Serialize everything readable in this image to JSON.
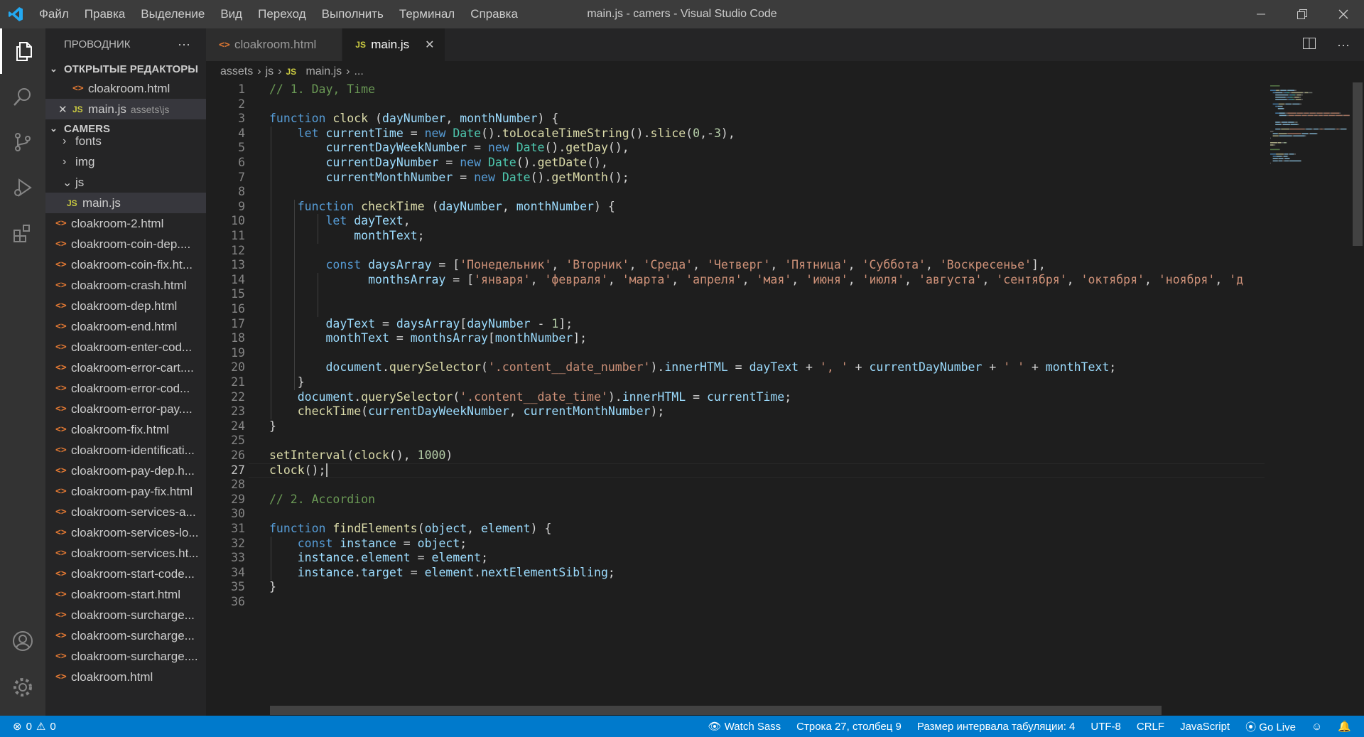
{
  "app": {
    "title": "main.js - camers - Visual Studio Code"
  },
  "menu": [
    "Файл",
    "Правка",
    "Выделение",
    "Вид",
    "Переход",
    "Выполнить",
    "Терминал",
    "Справка"
  ],
  "colors": {
    "titlebar": "#3c3c3c",
    "activitybar": "#333333",
    "sidebar": "#252526",
    "editor": "#1e1e1e",
    "statusbar": "#007acc",
    "accent": "#007acc"
  },
  "activity_icons": [
    "files-icon",
    "search-icon",
    "source-control-icon",
    "run-debug-icon",
    "extensions-icon",
    "account-icon",
    "settings-gear-icon"
  ],
  "sidebar": {
    "title": "ПРОВОДНИК",
    "more": "···",
    "open_editors_title": "ОТКРЫТЫЕ РЕДАКТОРЫ",
    "open_editors": [
      {
        "name": "cloakroom.html",
        "desc": "",
        "type": "html",
        "close": ""
      },
      {
        "name": "main.js",
        "desc": "assets\\js",
        "type": "js",
        "close": "✕"
      }
    ],
    "folder_title": "CAMERS",
    "tree": [
      {
        "name": "fonts",
        "kind": "folder",
        "chev": "›",
        "indent": 1
      },
      {
        "name": "img",
        "kind": "folder",
        "chev": "›",
        "indent": 1
      },
      {
        "name": "js",
        "kind": "folder",
        "chev": "⌄",
        "indent": 1
      },
      {
        "name": "main.js",
        "kind": "js",
        "chev": "",
        "indent": 2
      },
      {
        "name": "cloakroom-2.html",
        "kind": "html"
      },
      {
        "name": "cloakroom-coin-dep....",
        "kind": "html"
      },
      {
        "name": "cloakroom-coin-fix.ht...",
        "kind": "html"
      },
      {
        "name": "cloakroom-crash.html",
        "kind": "html"
      },
      {
        "name": "cloakroom-dep.html",
        "kind": "html"
      },
      {
        "name": "cloakroom-end.html",
        "kind": "html"
      },
      {
        "name": "cloakroom-enter-cod...",
        "kind": "html"
      },
      {
        "name": "cloakroom-error-cart....",
        "kind": "html"
      },
      {
        "name": "cloakroom-error-cod...",
        "kind": "html"
      },
      {
        "name": "cloakroom-error-pay....",
        "kind": "html"
      },
      {
        "name": "cloakroom-fix.html",
        "kind": "html"
      },
      {
        "name": "cloakroom-identificati...",
        "kind": "html"
      },
      {
        "name": "cloakroom-pay-dep.h...",
        "kind": "html"
      },
      {
        "name": "cloakroom-pay-fix.html",
        "kind": "html"
      },
      {
        "name": "cloakroom-services-a...",
        "kind": "html"
      },
      {
        "name": "cloakroom-services-lo...",
        "kind": "html"
      },
      {
        "name": "cloakroom-services.ht...",
        "kind": "html"
      },
      {
        "name": "cloakroom-start-code...",
        "kind": "html"
      },
      {
        "name": "cloakroom-start.html",
        "kind": "html"
      },
      {
        "name": "cloakroom-surcharge...",
        "kind": "html"
      },
      {
        "name": "cloakroom-surcharge...",
        "kind": "html"
      },
      {
        "name": "cloakroom-surcharge....",
        "kind": "html"
      },
      {
        "name": "cloakroom.html",
        "kind": "html"
      }
    ]
  },
  "tabs": [
    {
      "label": "cloakroom.html",
      "type": "html",
      "active": false,
      "close": ""
    },
    {
      "label": "main.js",
      "type": "js",
      "active": true,
      "close": "✕"
    }
  ],
  "breadcrumb": [
    "assets",
    "js",
    "main.js",
    "..."
  ],
  "editor": {
    "current_line": 27,
    "lines": [
      [
        [
          "c",
          "// 1. Day, Time"
        ]
      ],
      [],
      [
        [
          "k",
          "function "
        ],
        [
          "f",
          "clock"
        ],
        [
          "p",
          " ("
        ],
        [
          "v",
          "dayNumber"
        ],
        [
          "p",
          ", "
        ],
        [
          "v",
          "monthNumber"
        ],
        [
          "p",
          ") {"
        ]
      ],
      [
        [
          "p",
          "    "
        ],
        [
          "k",
          "let "
        ],
        [
          "v",
          "currentTime"
        ],
        [
          "p",
          " = "
        ],
        [
          "k",
          "new "
        ],
        [
          "t",
          "Date"
        ],
        [
          "p",
          "()."
        ],
        [
          "f",
          "toLocaleTimeString"
        ],
        [
          "p",
          "()."
        ],
        [
          "f",
          "slice"
        ],
        [
          "p",
          "("
        ],
        [
          "n",
          "0"
        ],
        [
          "p",
          ",-"
        ],
        [
          "n",
          "3"
        ],
        [
          "p",
          "),"
        ]
      ],
      [
        [
          "p",
          "        "
        ],
        [
          "v",
          "currentDayWeekNumber"
        ],
        [
          "p",
          " = "
        ],
        [
          "k",
          "new "
        ],
        [
          "t",
          "Date"
        ],
        [
          "p",
          "()."
        ],
        [
          "f",
          "getDay"
        ],
        [
          "p",
          "(),"
        ]
      ],
      [
        [
          "p",
          "        "
        ],
        [
          "v",
          "currentDayNumber"
        ],
        [
          "p",
          " = "
        ],
        [
          "k",
          "new "
        ],
        [
          "t",
          "Date"
        ],
        [
          "p",
          "()."
        ],
        [
          "f",
          "getDate"
        ],
        [
          "p",
          "(),"
        ]
      ],
      [
        [
          "p",
          "        "
        ],
        [
          "v",
          "currentMonthNumber"
        ],
        [
          "p",
          " = "
        ],
        [
          "k",
          "new "
        ],
        [
          "t",
          "Date"
        ],
        [
          "p",
          "()."
        ],
        [
          "f",
          "getMonth"
        ],
        [
          "p",
          "();"
        ]
      ],
      [],
      [
        [
          "p",
          "    "
        ],
        [
          "k",
          "function "
        ],
        [
          "f",
          "checkTime"
        ],
        [
          "p",
          " ("
        ],
        [
          "v",
          "dayNumber"
        ],
        [
          "p",
          ", "
        ],
        [
          "v",
          "monthNumber"
        ],
        [
          "p",
          ") {"
        ]
      ],
      [
        [
          "p",
          "        "
        ],
        [
          "k",
          "let "
        ],
        [
          "v",
          "dayText"
        ],
        [
          "p",
          ","
        ]
      ],
      [
        [
          "p",
          "            "
        ],
        [
          "v",
          "monthText"
        ],
        [
          "p",
          ";"
        ]
      ],
      [],
      [
        [
          "p",
          "        "
        ],
        [
          "k",
          "const "
        ],
        [
          "v",
          "daysArray"
        ],
        [
          "p",
          " = ["
        ],
        [
          "s",
          "'Понедельник'"
        ],
        [
          "p",
          ", "
        ],
        [
          "s",
          "'Вторник'"
        ],
        [
          "p",
          ", "
        ],
        [
          "s",
          "'Среда'"
        ],
        [
          "p",
          ", "
        ],
        [
          "s",
          "'Четверг'"
        ],
        [
          "p",
          ", "
        ],
        [
          "s",
          "'Пятница'"
        ],
        [
          "p",
          ", "
        ],
        [
          "s",
          "'Суббота'"
        ],
        [
          "p",
          ", "
        ],
        [
          "s",
          "'Воскресенье'"
        ],
        [
          "p",
          "],"
        ]
      ],
      [
        [
          "p",
          "              "
        ],
        [
          "v",
          "monthsArray"
        ],
        [
          "p",
          " = ["
        ],
        [
          "s",
          "'января'"
        ],
        [
          "p",
          ", "
        ],
        [
          "s",
          "'февраля'"
        ],
        [
          "p",
          ", "
        ],
        [
          "s",
          "'марта'"
        ],
        [
          "p",
          ", "
        ],
        [
          "s",
          "'апреля'"
        ],
        [
          "p",
          ", "
        ],
        [
          "s",
          "'мая'"
        ],
        [
          "p",
          ", "
        ],
        [
          "s",
          "'июня'"
        ],
        [
          "p",
          ", "
        ],
        [
          "s",
          "'июля'"
        ],
        [
          "p",
          ", "
        ],
        [
          "s",
          "'августа'"
        ],
        [
          "p",
          ", "
        ],
        [
          "s",
          "'сентября'"
        ],
        [
          "p",
          ", "
        ],
        [
          "s",
          "'октября'"
        ],
        [
          "p",
          ", "
        ],
        [
          "s",
          "'ноября'"
        ],
        [
          "p",
          ", "
        ],
        [
          "s",
          "'д"
        ]
      ],
      [],
      [],
      [
        [
          "p",
          "        "
        ],
        [
          "v",
          "dayText"
        ],
        [
          "p",
          " = "
        ],
        [
          "v",
          "daysArray"
        ],
        [
          "p",
          "["
        ],
        [
          "v",
          "dayNumber"
        ],
        [
          "p",
          " - "
        ],
        [
          "n",
          "1"
        ],
        [
          "p",
          "];"
        ]
      ],
      [
        [
          "p",
          "        "
        ],
        [
          "v",
          "monthText"
        ],
        [
          "p",
          " = "
        ],
        [
          "v",
          "monthsArray"
        ],
        [
          "p",
          "["
        ],
        [
          "v",
          "monthNumber"
        ],
        [
          "p",
          "];"
        ]
      ],
      [],
      [
        [
          "p",
          "        "
        ],
        [
          "v",
          "document"
        ],
        [
          "p",
          "."
        ],
        [
          "f",
          "querySelector"
        ],
        [
          "p",
          "("
        ],
        [
          "s",
          "'.content__date_number'"
        ],
        [
          "p",
          ")."
        ],
        [
          "v",
          "innerHTML"
        ],
        [
          "p",
          " = "
        ],
        [
          "v",
          "dayText"
        ],
        [
          "p",
          " + "
        ],
        [
          "s",
          "', '"
        ],
        [
          "p",
          " + "
        ],
        [
          "v",
          "currentDayNumber"
        ],
        [
          "p",
          " + "
        ],
        [
          "s",
          "' '"
        ],
        [
          "p",
          " + "
        ],
        [
          "v",
          "monthText"
        ],
        [
          "p",
          ";"
        ]
      ],
      [
        [
          "p",
          "    }"
        ]
      ],
      [
        [
          "p",
          "    "
        ],
        [
          "v",
          "document"
        ],
        [
          "p",
          "."
        ],
        [
          "f",
          "querySelector"
        ],
        [
          "p",
          "("
        ],
        [
          "s",
          "'.content__date_time'"
        ],
        [
          "p",
          ")."
        ],
        [
          "v",
          "innerHTML"
        ],
        [
          "p",
          " = "
        ],
        [
          "v",
          "currentTime"
        ],
        [
          "p",
          ";"
        ]
      ],
      [
        [
          "p",
          "    "
        ],
        [
          "f",
          "checkTime"
        ],
        [
          "p",
          "("
        ],
        [
          "v",
          "currentDayWeekNumber"
        ],
        [
          "p",
          ", "
        ],
        [
          "v",
          "currentMonthNumber"
        ],
        [
          "p",
          ");"
        ]
      ],
      [
        [
          "p",
          "}"
        ]
      ],
      [],
      [
        [
          "f",
          "setInterval"
        ],
        [
          "p",
          "("
        ],
        [
          "f",
          "clock"
        ],
        [
          "p",
          "(), "
        ],
        [
          "n",
          "1000"
        ],
        [
          "p",
          ")"
        ]
      ],
      [
        [
          "f",
          "clock"
        ],
        [
          "p",
          "();"
        ]
      ],
      [],
      [
        [
          "c",
          "// 2. Accordion"
        ]
      ],
      [],
      [
        [
          "k",
          "function "
        ],
        [
          "f",
          "findElements"
        ],
        [
          "p",
          "("
        ],
        [
          "v",
          "object"
        ],
        [
          "p",
          ", "
        ],
        [
          "v",
          "element"
        ],
        [
          "p",
          ") {"
        ]
      ],
      [
        [
          "p",
          "    "
        ],
        [
          "k",
          "const "
        ],
        [
          "v",
          "instance"
        ],
        [
          "p",
          " = "
        ],
        [
          "v",
          "object"
        ],
        [
          "p",
          ";"
        ]
      ],
      [
        [
          "p",
          "    "
        ],
        [
          "v",
          "instance"
        ],
        [
          "p",
          "."
        ],
        [
          "v",
          "element"
        ],
        [
          "p",
          " = "
        ],
        [
          "v",
          "element"
        ],
        [
          "p",
          ";"
        ]
      ],
      [
        [
          "p",
          "    "
        ],
        [
          "v",
          "instance"
        ],
        [
          "p",
          "."
        ],
        [
          "v",
          "target"
        ],
        [
          "p",
          " = "
        ],
        [
          "v",
          "element"
        ],
        [
          "p",
          "."
        ],
        [
          "v",
          "nextElementSibling"
        ],
        [
          "p",
          ";"
        ]
      ],
      [
        [
          "p",
          "}"
        ]
      ],
      []
    ]
  },
  "statusbar": {
    "errors": "0",
    "warnings": "0",
    "watch_sass": "Watch Sass",
    "position": "Строка 27, столбец 9",
    "indent": "Размер интервала табуляции: 4",
    "encoding": "UTF-8",
    "eol": "CRLF",
    "language": "JavaScript",
    "go_live": "Go Live"
  }
}
